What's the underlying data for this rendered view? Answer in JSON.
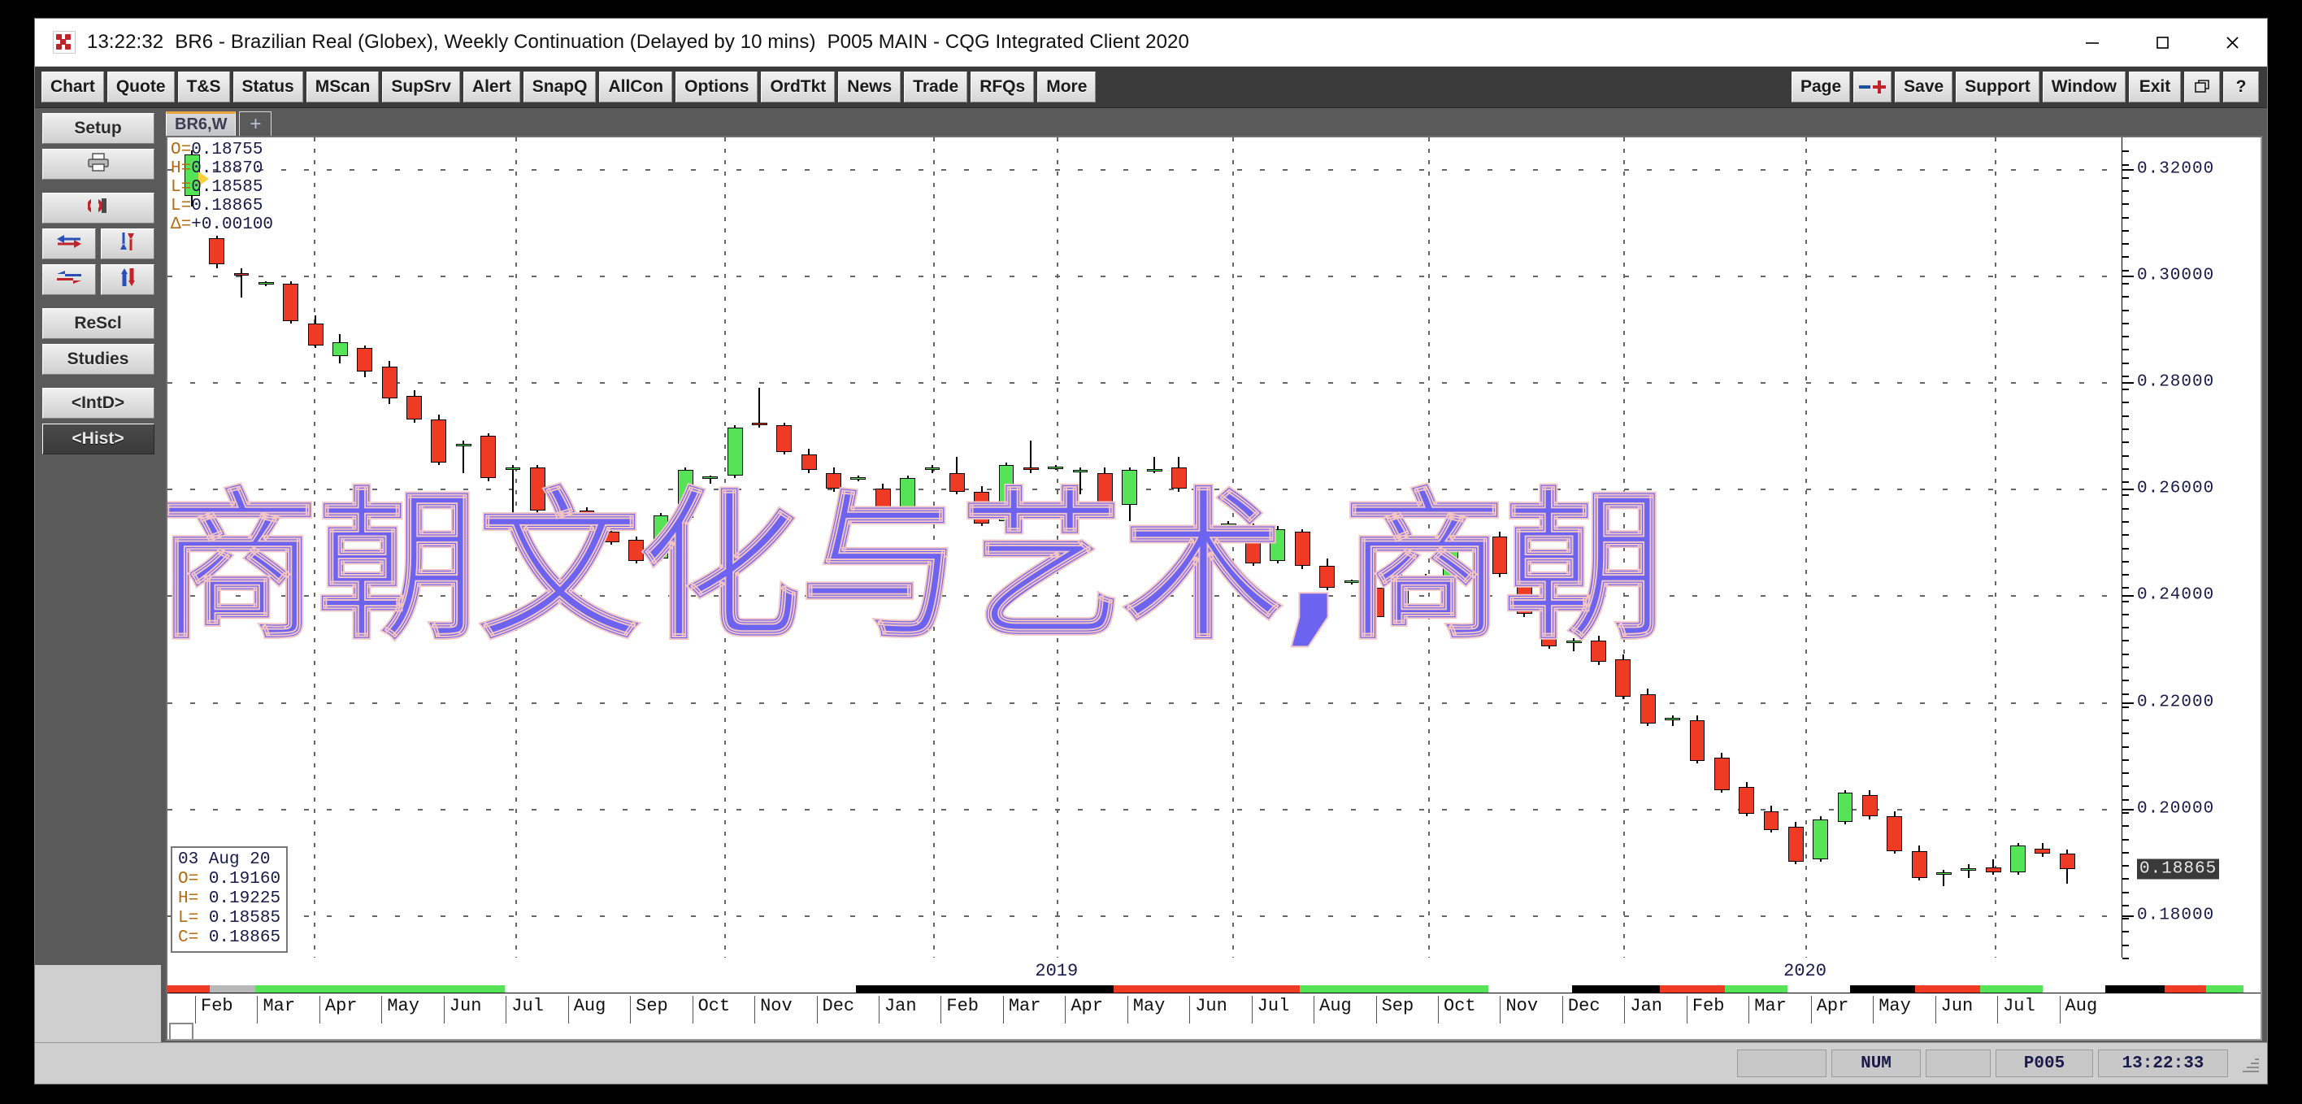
{
  "window": {
    "title_time": "13:22:32",
    "title_main": "BR6 - Brazilian Real (Globex), Weekly Continuation (Delayed by 10 mins)",
    "title_suffix": "P005 MAIN - CQG Integrated Client 2020",
    "minimize": "—",
    "maximize": "□",
    "close": "✕"
  },
  "menubar": {
    "left_buttons": [
      "Chart",
      "Quote",
      "T&S",
      "Status",
      "MScan",
      "SupSrv",
      "Alert",
      "SnapQ",
      "AllCon",
      "Options",
      "OrdTkt",
      "News",
      "Trade",
      "RFQs",
      "More"
    ],
    "right_buttons": [
      "Page",
      "Save",
      "Support",
      "Window",
      "Exit"
    ],
    "zoom_icon": "zoom-in-out-icon",
    "restore_icon": "restore-icon",
    "help_icon": "?"
  },
  "sidebar": {
    "setup": "Setup",
    "print_icon": "printer-icon",
    "magnet_icon": "magnet-icon",
    "arrows_h": "horizontal-arrows-icon",
    "arrows_v": "vertical-arrows-icon",
    "arrows_collapse": "collapse-arrows-icon",
    "arrows_split": "split-arrows-icon",
    "rescale": "ReScl",
    "studies": "Studies",
    "intraday": "<IntD>",
    "historical": "<Hist>"
  },
  "tabs": {
    "active": "BR6,W",
    "add": "+"
  },
  "overlay_text": "商朝文化与艺术,商朝",
  "ohlc_readout": {
    "open_label": "O=",
    "open": "0.18755",
    "high_label": "H=",
    "high": "0.18870",
    "low_label": "L=",
    "low": "0.18585",
    "close_label": "L=",
    "close": "0.18865",
    "delta_label": "Δ=",
    "delta": "+0.00100"
  },
  "cursor_box": {
    "date": "03 Aug 20",
    "open_label": "O=",
    "open": "0.19160",
    "high_label": "H=",
    "high": "0.19225",
    "low_label": "L=",
    "low": "0.18585",
    "close_label": "C=",
    "close": "0.18865"
  },
  "statusbar": {
    "num": "NUM",
    "page": "P005",
    "time": "13:22:33"
  },
  "colors": {
    "up": "#57e357",
    "down": "#f03b24",
    "overlay": "#6c63f0",
    "accent_tab": "#e8a33d",
    "axis_text": "#1a1a4a"
  },
  "chart_data": {
    "type": "line",
    "subtype": "candlestick",
    "title": "BR6 - Brazilian Real (Globex), Weekly Continuation",
    "xlabel": "",
    "ylabel": "",
    "grid": true,
    "legend": null,
    "ylim": [
      0.172,
      0.326
    ],
    "yticks": [
      0.32,
      0.3,
      0.28,
      0.26,
      0.24,
      0.22,
      0.2,
      0.18
    ],
    "ytick_labels": [
      "0.32000",
      "0.30000",
      "0.28000",
      "0.26000",
      "0.24000",
      "0.22000",
      "0.20000",
      "0.18000"
    ],
    "highlighted_price": "0.18865",
    "year_labels": [
      {
        "label": "2019",
        "x_frac": 0.455
      },
      {
        "label": "2020",
        "x_frac": 0.838
      }
    ],
    "month_labels": [
      "Feb",
      "Mar",
      "Apr",
      "May",
      "Jun",
      "Jul",
      "Aug",
      "Sep",
      "Oct",
      "Nov",
      "Dec",
      "Jan",
      "Feb",
      "Mar",
      "Apr",
      "May",
      "Jun",
      "Jul",
      "Aug",
      "Sep",
      "Oct",
      "Nov",
      "Dec",
      "Jan",
      "Feb",
      "Mar",
      "Apr",
      "May",
      "Jun",
      "Jul",
      "Aug"
    ],
    "season_segments": [
      {
        "x_frac": 0.0,
        "w_frac": 0.02,
        "color": "#f03b24"
      },
      {
        "x_frac": 0.02,
        "w_frac": 0.022,
        "color": "#b8b8b8"
      },
      {
        "x_frac": 0.042,
        "w_frac": 0.119,
        "color": "#57e357"
      },
      {
        "x_frac": 0.161,
        "w_frac": 0.168,
        "color": "#ffffff"
      },
      {
        "x_frac": 0.329,
        "w_frac": 0.123,
        "color": "#000000"
      },
      {
        "x_frac": 0.452,
        "w_frac": 0.089,
        "color": "#f03b24"
      },
      {
        "x_frac": 0.541,
        "w_frac": 0.09,
        "color": "#57e357"
      },
      {
        "x_frac": 0.631,
        "w_frac": 0.04,
        "color": "#ffffff"
      },
      {
        "x_frac": 0.671,
        "w_frac": 0.042,
        "color": "#000000"
      },
      {
        "x_frac": 0.713,
        "w_frac": 0.031,
        "color": "#f03b24"
      },
      {
        "x_frac": 0.744,
        "w_frac": 0.03,
        "color": "#57e357"
      },
      {
        "x_frac": 0.774,
        "w_frac": 0.03,
        "color": "#ffffff"
      },
      {
        "x_frac": 0.804,
        "w_frac": 0.031,
        "color": "#000000"
      },
      {
        "x_frac": 0.835,
        "w_frac": 0.031,
        "color": "#f03b24"
      },
      {
        "x_frac": 0.866,
        "w_frac": 0.03,
        "color": "#57e357"
      },
      {
        "x_frac": 0.896,
        "w_frac": 0.03,
        "color": "#ffffff"
      },
      {
        "x_frac": 0.926,
        "w_frac": 0.028,
        "color": "#000000"
      },
      {
        "x_frac": 0.954,
        "w_frac": 0.02,
        "color": "#f03b24"
      },
      {
        "x_frac": 0.974,
        "w_frac": 0.018,
        "color": "#57e357"
      },
      {
        "x_frac": 0.992,
        "w_frac": 0.008,
        "color": "#ffffff"
      }
    ],
    "candles": [
      {
        "o": 0.315,
        "h": 0.3235,
        "l": 0.313,
        "c": 0.3228,
        "d": 1
      },
      {
        "o": 0.307,
        "h": 0.3075,
        "l": 0.3015,
        "c": 0.3022,
        "d": 0
      },
      {
        "o": 0.3005,
        "h": 0.3015,
        "l": 0.296,
        "c": 0.3,
        "d": 0
      },
      {
        "o": 0.2985,
        "h": 0.299,
        "l": 0.298,
        "c": 0.2988,
        "d": 1
      },
      {
        "o": 0.2985,
        "h": 0.299,
        "l": 0.291,
        "c": 0.2915,
        "d": 0
      },
      {
        "o": 0.291,
        "h": 0.2925,
        "l": 0.2865,
        "c": 0.287,
        "d": 0
      },
      {
        "o": 0.285,
        "h": 0.289,
        "l": 0.2835,
        "c": 0.2875,
        "d": 1
      },
      {
        "o": 0.2865,
        "h": 0.287,
        "l": 0.281,
        "c": 0.282,
        "d": 0
      },
      {
        "o": 0.283,
        "h": 0.284,
        "l": 0.276,
        "c": 0.277,
        "d": 0
      },
      {
        "o": 0.2775,
        "h": 0.2785,
        "l": 0.2725,
        "c": 0.273,
        "d": 0
      },
      {
        "o": 0.273,
        "h": 0.274,
        "l": 0.2645,
        "c": 0.265,
        "d": 0
      },
      {
        "o": 0.268,
        "h": 0.269,
        "l": 0.263,
        "c": 0.2685,
        "d": 1
      },
      {
        "o": 0.27,
        "h": 0.2705,
        "l": 0.2615,
        "c": 0.262,
        "d": 0
      },
      {
        "o": 0.264,
        "h": 0.2645,
        "l": 0.254,
        "c": 0.2638,
        "d": 1
      },
      {
        "o": 0.264,
        "h": 0.2645,
        "l": 0.2555,
        "c": 0.256,
        "d": 0
      },
      {
        "o": 0.257,
        "h": 0.2575,
        "l": 0.256,
        "c": 0.2572,
        "d": 1
      },
      {
        "o": 0.256,
        "h": 0.2565,
        "l": 0.2525,
        "c": 0.253,
        "d": 0
      },
      {
        "o": 0.252,
        "h": 0.2525,
        "l": 0.2495,
        "c": 0.25,
        "d": 0
      },
      {
        "o": 0.2505,
        "h": 0.251,
        "l": 0.246,
        "c": 0.2465,
        "d": 0
      },
      {
        "o": 0.247,
        "h": 0.2555,
        "l": 0.2465,
        "c": 0.255,
        "d": 1
      },
      {
        "o": 0.2545,
        "h": 0.264,
        "l": 0.254,
        "c": 0.2635,
        "d": 1
      },
      {
        "o": 0.262,
        "h": 0.2625,
        "l": 0.261,
        "c": 0.2623,
        "d": 1
      },
      {
        "o": 0.2625,
        "h": 0.272,
        "l": 0.262,
        "c": 0.2715,
        "d": 1
      },
      {
        "o": 0.272,
        "h": 0.279,
        "l": 0.2715,
        "c": 0.2725,
        "d": 0
      },
      {
        "o": 0.272,
        "h": 0.2725,
        "l": 0.2665,
        "c": 0.267,
        "d": 0
      },
      {
        "o": 0.2665,
        "h": 0.2675,
        "l": 0.263,
        "c": 0.2635,
        "d": 0
      },
      {
        "o": 0.263,
        "h": 0.264,
        "l": 0.2595,
        "c": 0.26,
        "d": 0
      },
      {
        "o": 0.262,
        "h": 0.2625,
        "l": 0.2615,
        "c": 0.2622,
        "d": 1
      },
      {
        "o": 0.26,
        "h": 0.261,
        "l": 0.2555,
        "c": 0.256,
        "d": 0
      },
      {
        "o": 0.2555,
        "h": 0.2625,
        "l": 0.255,
        "c": 0.262,
        "d": 1
      },
      {
        "o": 0.2635,
        "h": 0.2645,
        "l": 0.263,
        "c": 0.264,
        "d": 1
      },
      {
        "o": 0.263,
        "h": 0.266,
        "l": 0.259,
        "c": 0.2595,
        "d": 0
      },
      {
        "o": 0.2595,
        "h": 0.2605,
        "l": 0.253,
        "c": 0.2535,
        "d": 0
      },
      {
        "o": 0.254,
        "h": 0.265,
        "l": 0.2535,
        "c": 0.2645,
        "d": 1
      },
      {
        "o": 0.264,
        "h": 0.269,
        "l": 0.263,
        "c": 0.2635,
        "d": 0
      },
      {
        "o": 0.264,
        "h": 0.2645,
        "l": 0.2635,
        "c": 0.2642,
        "d": 1
      },
      {
        "o": 0.2635,
        "h": 0.264,
        "l": 0.259,
        "c": 0.2635,
        "d": 1
      },
      {
        "o": 0.263,
        "h": 0.264,
        "l": 0.257,
        "c": 0.2575,
        "d": 0
      },
      {
        "o": 0.257,
        "h": 0.264,
        "l": 0.254,
        "c": 0.2635,
        "d": 1
      },
      {
        "o": 0.2635,
        "h": 0.266,
        "l": 0.263,
        "c": 0.2638,
        "d": 1
      },
      {
        "o": 0.264,
        "h": 0.266,
        "l": 0.2595,
        "c": 0.26,
        "d": 0
      },
      {
        "o": 0.2595,
        "h": 0.2605,
        "l": 0.2525,
        "c": 0.253,
        "d": 0
      },
      {
        "o": 0.253,
        "h": 0.254,
        "l": 0.2525,
        "c": 0.2535,
        "d": 1
      },
      {
        "o": 0.2525,
        "h": 0.2535,
        "l": 0.2455,
        "c": 0.246,
        "d": 0
      },
      {
        "o": 0.2465,
        "h": 0.253,
        "l": 0.246,
        "c": 0.2525,
        "d": 1
      },
      {
        "o": 0.252,
        "h": 0.2525,
        "l": 0.245,
        "c": 0.2455,
        "d": 0
      },
      {
        "o": 0.2455,
        "h": 0.247,
        "l": 0.241,
        "c": 0.2415,
        "d": 0
      },
      {
        "o": 0.2425,
        "h": 0.243,
        "l": 0.242,
        "c": 0.2428,
        "d": 1
      },
      {
        "o": 0.2415,
        "h": 0.2425,
        "l": 0.2355,
        "c": 0.236,
        "d": 0
      },
      {
        "o": 0.2365,
        "h": 0.244,
        "l": 0.236,
        "c": 0.2435,
        "d": 1
      },
      {
        "o": 0.243,
        "h": 0.244,
        "l": 0.242,
        "c": 0.2435,
        "d": 1
      },
      {
        "o": 0.2435,
        "h": 0.251,
        "l": 0.243,
        "c": 0.2505,
        "d": 1
      },
      {
        "o": 0.25,
        "h": 0.251,
        "l": 0.249,
        "c": 0.2505,
        "d": 1
      },
      {
        "o": 0.251,
        "h": 0.252,
        "l": 0.2435,
        "c": 0.244,
        "d": 0
      },
      {
        "o": 0.244,
        "h": 0.245,
        "l": 0.236,
        "c": 0.2365,
        "d": 0
      },
      {
        "o": 0.237,
        "h": 0.2375,
        "l": 0.23,
        "c": 0.2305,
        "d": 0
      },
      {
        "o": 0.231,
        "h": 0.232,
        "l": 0.2295,
        "c": 0.2315,
        "d": 1
      },
      {
        "o": 0.2315,
        "h": 0.2325,
        "l": 0.227,
        "c": 0.2275,
        "d": 0
      },
      {
        "o": 0.228,
        "h": 0.229,
        "l": 0.2205,
        "c": 0.221,
        "d": 0
      },
      {
        "o": 0.2215,
        "h": 0.2225,
        "l": 0.2155,
        "c": 0.216,
        "d": 0
      },
      {
        "o": 0.2165,
        "h": 0.2175,
        "l": 0.2155,
        "c": 0.217,
        "d": 1
      },
      {
        "o": 0.2165,
        "h": 0.2175,
        "l": 0.2085,
        "c": 0.209,
        "d": 0
      },
      {
        "o": 0.2095,
        "h": 0.2105,
        "l": 0.203,
        "c": 0.2035,
        "d": 0
      },
      {
        "o": 0.204,
        "h": 0.205,
        "l": 0.1985,
        "c": 0.199,
        "d": 0
      },
      {
        "o": 0.1995,
        "h": 0.2005,
        "l": 0.1955,
        "c": 0.196,
        "d": 0
      },
      {
        "o": 0.1965,
        "h": 0.1975,
        "l": 0.1895,
        "c": 0.19,
        "d": 0
      },
      {
        "o": 0.1905,
        "h": 0.1985,
        "l": 0.19,
        "c": 0.198,
        "d": 1
      },
      {
        "o": 0.1975,
        "h": 0.2035,
        "l": 0.197,
        "c": 0.203,
        "d": 1
      },
      {
        "o": 0.2025,
        "h": 0.2035,
        "l": 0.198,
        "c": 0.1985,
        "d": 0
      },
      {
        "o": 0.1985,
        "h": 0.1995,
        "l": 0.1915,
        "c": 0.192,
        "d": 0
      },
      {
        "o": 0.192,
        "h": 0.193,
        "l": 0.1865,
        "c": 0.187,
        "d": 0
      },
      {
        "o": 0.1875,
        "h": 0.1885,
        "l": 0.1855,
        "c": 0.188,
        "d": 1
      },
      {
        "o": 0.1885,
        "h": 0.1895,
        "l": 0.187,
        "c": 0.1888,
        "d": 1
      },
      {
        "o": 0.189,
        "h": 0.1905,
        "l": 0.1875,
        "c": 0.188,
        "d": 0
      },
      {
        "o": 0.188,
        "h": 0.1935,
        "l": 0.1875,
        "c": 0.193,
        "d": 1
      },
      {
        "o": 0.1916,
        "h": 0.1935,
        "l": 0.191,
        "c": 0.1925,
        "d": 0
      },
      {
        "o": 0.1916,
        "h": 0.19225,
        "l": 0.18585,
        "c": 0.18865,
        "d": 0
      }
    ]
  }
}
